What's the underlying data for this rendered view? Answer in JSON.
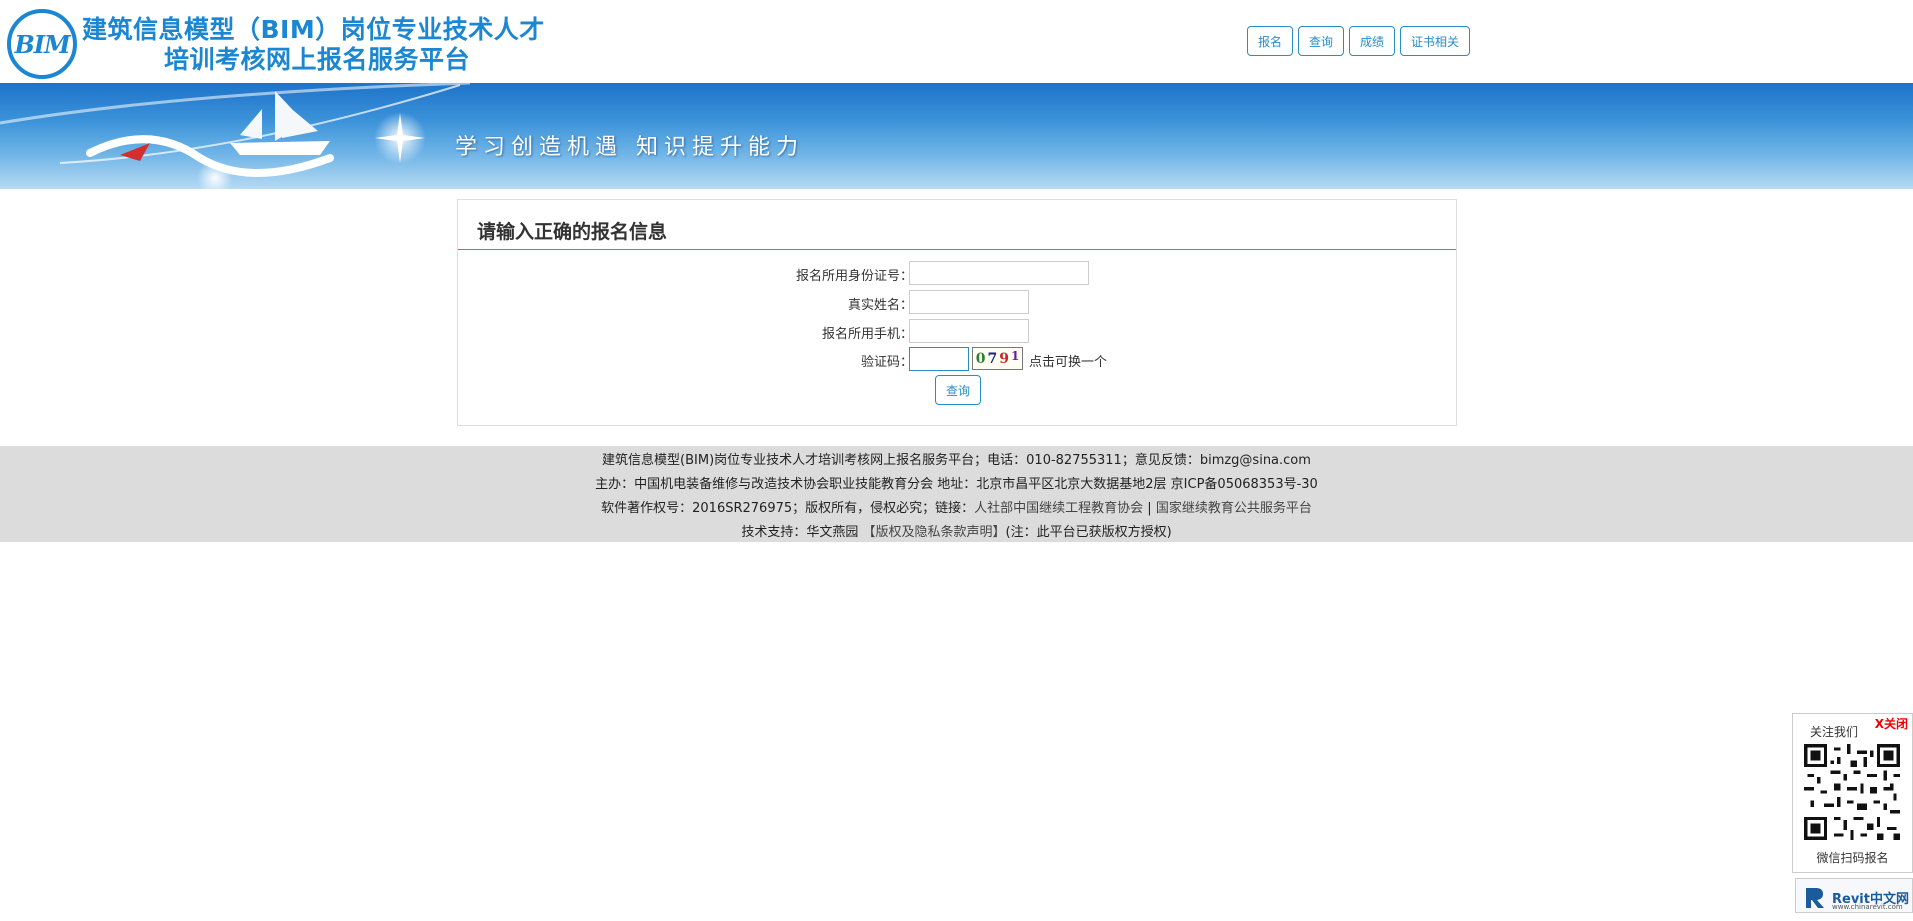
{
  "header": {
    "logo_text": "BIM",
    "title_line1": "建筑信息模型（BIM）岗位专业技术人才",
    "title_line2": "培训考核网上报名服务平台"
  },
  "nav": {
    "items": [
      "报名",
      "查询",
      "成绩",
      "证书相关"
    ]
  },
  "banner": {
    "slogan": "学习创造机遇  知识提升能力"
  },
  "form": {
    "title": "请输入正确的报名信息",
    "id_label": "报名所用身份证号：",
    "id_value": "",
    "name_label": "真实姓名：",
    "name_value": "",
    "phone_label": "报名所用手机：",
    "phone_value": "",
    "captcha_label": "验证码：",
    "captcha_value": "",
    "captcha_chars": [
      "0",
      "7",
      "9",
      "1"
    ],
    "captcha_hint": "点击可换一个",
    "submit_label": "查询"
  },
  "footer": {
    "line1": "建筑信息模型(BIM)岗位专业技术人才培训考核网上报名服务平台；电话：010-82755311；意见反馈：bimzg@sina.com",
    "line2": "主办：中国机电装备维修与改造技术协会职业技能教育分会 地址：北京市昌平区北京大数据基地2层 京ICP备05068353号-30",
    "line3_prefix": "软件著作权号：2016SR276975；版权所有，侵权必究；链接：",
    "link1": "人社部中国继续工程教育协会",
    "separator": "|",
    "link2": "国家继续教育公共服务平台",
    "line4_prefix": "技术支持：华文燕园 ",
    "privacy_link": "【版权及隐私条款声明】",
    "line4_suffix": "(注：此平台已获版权方授权)"
  },
  "qr_float": {
    "close_label": "X关闭",
    "follow_label": "关注我们",
    "scan_label": "微信扫码报名"
  },
  "revit_badge": {
    "title": "Revit中文网",
    "url": "www.chinarevit.com"
  },
  "colors": {
    "brand_blue": "#1b86d1",
    "button_border": "#2a8dc8",
    "footer_bg": "#dcdcdc",
    "close_red": "#ee0000"
  }
}
